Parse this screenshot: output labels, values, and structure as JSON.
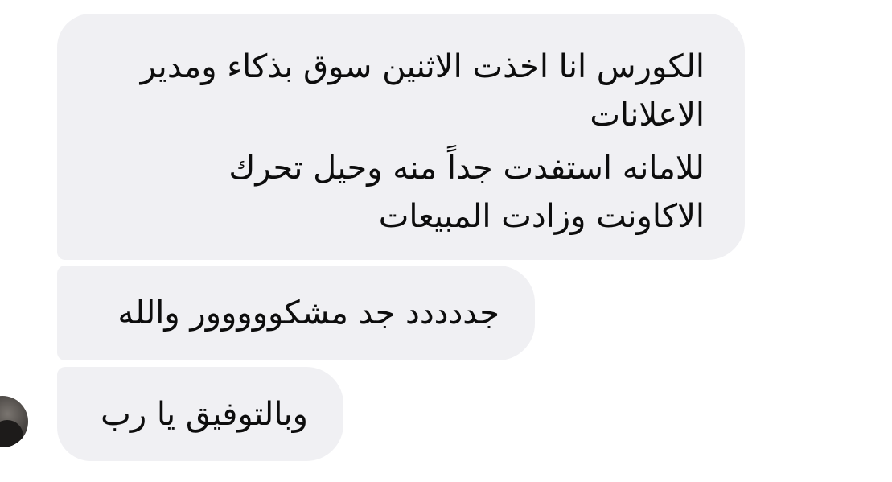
{
  "messages": [
    {
      "lines": [
        "الكورس انا اخذت الاثنين سوق بذكاء ومدير",
        "الاعلانات",
        "للامانه استفدت جداً منه وحيل تحرك",
        "الاكاونت وزادت المبيعات"
      ]
    },
    {
      "lines": [
        "جددددد جد مشكووووور والله"
      ]
    },
    {
      "lines": [
        "وبالتوفيق يا رب"
      ]
    }
  ],
  "colors": {
    "bubble_background": "#f0f0f3",
    "text": "#0d0d0d",
    "page_background": "#ffffff"
  },
  "icons": {
    "avatar": "sender-avatar"
  }
}
